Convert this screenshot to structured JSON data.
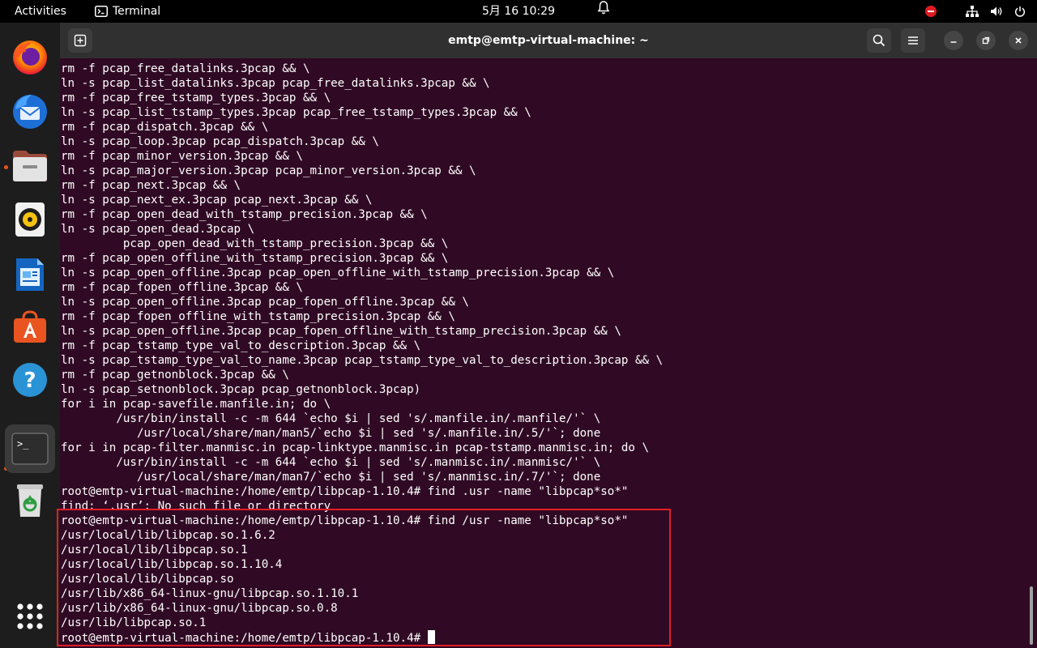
{
  "topbar": {
    "activities": "Activities",
    "app_name": "Terminal",
    "clock": "5月 16  10:29",
    "icons": [
      "notification-bell-icon",
      "do-not-disturb-icon",
      "network-icon",
      "volume-icon",
      "power-icon"
    ]
  },
  "dock": {
    "apps": [
      "Firefox",
      "Thunderbird",
      "Files",
      "Rhythmbox",
      "LibreOffice Writer",
      "Ubuntu Software",
      "Help",
      "Terminal",
      "Trash",
      "Show Applications"
    ]
  },
  "window": {
    "title": "emtp@emtp-virtual-machine: ~"
  },
  "terminal": {
    "lines": [
      "rm -f pcap_free_datalinks.3pcap && \\",
      "ln -s pcap_list_datalinks.3pcap pcap_free_datalinks.3pcap && \\",
      "rm -f pcap_free_tstamp_types.3pcap && \\",
      "ln -s pcap_list_tstamp_types.3pcap pcap_free_tstamp_types.3pcap && \\",
      "rm -f pcap_dispatch.3pcap && \\",
      "ln -s pcap_loop.3pcap pcap_dispatch.3pcap && \\",
      "rm -f pcap_minor_version.3pcap && \\",
      "ln -s pcap_major_version.3pcap pcap_minor_version.3pcap && \\",
      "rm -f pcap_next.3pcap && \\",
      "ln -s pcap_next_ex.3pcap pcap_next.3pcap && \\",
      "rm -f pcap_open_dead_with_tstamp_precision.3pcap && \\",
      "ln -s pcap_open_dead.3pcap \\",
      "         pcap_open_dead_with_tstamp_precision.3pcap && \\",
      "rm -f pcap_open_offline_with_tstamp_precision.3pcap && \\",
      "ln -s pcap_open_offline.3pcap pcap_open_offline_with_tstamp_precision.3pcap && \\",
      "rm -f pcap_fopen_offline.3pcap && \\",
      "ln -s pcap_open_offline.3pcap pcap_fopen_offline.3pcap && \\",
      "rm -f pcap_fopen_offline_with_tstamp_precision.3pcap && \\",
      "ln -s pcap_open_offline.3pcap pcap_fopen_offline_with_tstamp_precision.3pcap && \\",
      "rm -f pcap_tstamp_type_val_to_description.3pcap && \\",
      "ln -s pcap_tstamp_type_val_to_name.3pcap pcap_tstamp_type_val_to_description.3pcap && \\",
      "rm -f pcap_getnonblock.3pcap && \\",
      "ln -s pcap_setnonblock.3pcap pcap_getnonblock.3pcap)",
      "for i in pcap-savefile.manfile.in; do \\",
      "        /usr/bin/install -c -m 644 `echo $i | sed 's/.manfile.in/.manfile/'` \\",
      "           /usr/local/share/man/man5/`echo $i | sed 's/.manfile.in/.5/'`; done",
      "for i in pcap-filter.manmisc.in pcap-linktype.manmisc.in pcap-tstamp.manmisc.in; do \\",
      "        /usr/bin/install -c -m 644 `echo $i | sed 's/.manmisc.in/.manmisc/'` \\",
      "           /usr/local/share/man/man7/`echo $i | sed 's/.manmisc.in/.7/'`; done",
      "root@emtp-virtual-machine:/home/emtp/libpcap-1.10.4# find .usr -name \"libpcap*so*\"",
      "find: ‘.usr’: No such file or directory",
      "root@emtp-virtual-machine:/home/emtp/libpcap-1.10.4# find /usr -name \"libpcap*so*\"",
      "/usr/local/lib/libpcap.so.1.6.2",
      "/usr/local/lib/libpcap.so.1",
      "/usr/local/lib/libpcap.so.1.10.4",
      "/usr/local/lib/libpcap.so",
      "/usr/lib/x86_64-linux-gnu/libpcap.so.1.10.1",
      "/usr/lib/x86_64-linux-gnu/libpcap.so.0.8",
      "/usr/lib/libpcap.so.1"
    ],
    "prompt": "root@emtp-virtual-machine:/home/emtp/libpcap-1.10.4# "
  },
  "colors": {
    "terminal_bg": "#300a24",
    "highlight": "#e21e26",
    "accent": "#e95420"
  }
}
